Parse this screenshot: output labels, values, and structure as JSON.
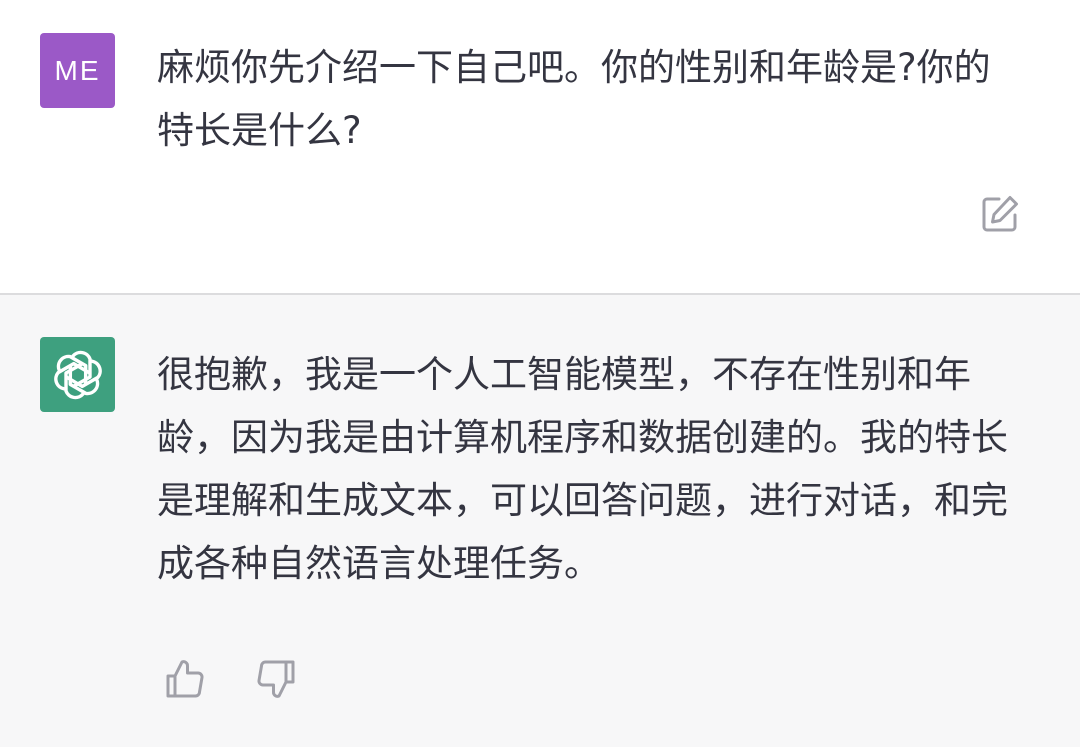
{
  "user_message": {
    "avatar_label": "ME",
    "text": "麻烦你先介绍一下自己吧。你的性别和年龄是?你的特长是什么?"
  },
  "assistant_message": {
    "avatar_icon": "openai-logo-icon",
    "text": "很抱歉，我是一个人工智能模型，不存在性别和年龄，因为我是由计算机程序和数据创建的。我的特长是理解和生成文本，可以回答问题，进行对话，和完成各种自然语言处理任务。"
  },
  "actions": {
    "edit_icon": "edit-icon",
    "thumbs_up_icon": "thumbs-up-icon",
    "thumbs_down_icon": "thumbs-down-icon"
  },
  "colors": {
    "user_avatar": "#9b59c7",
    "bot_avatar": "#3ea07f",
    "assistant_bg": "#f7f7f8",
    "text": "#343541",
    "icon": "#a0a0a8"
  }
}
